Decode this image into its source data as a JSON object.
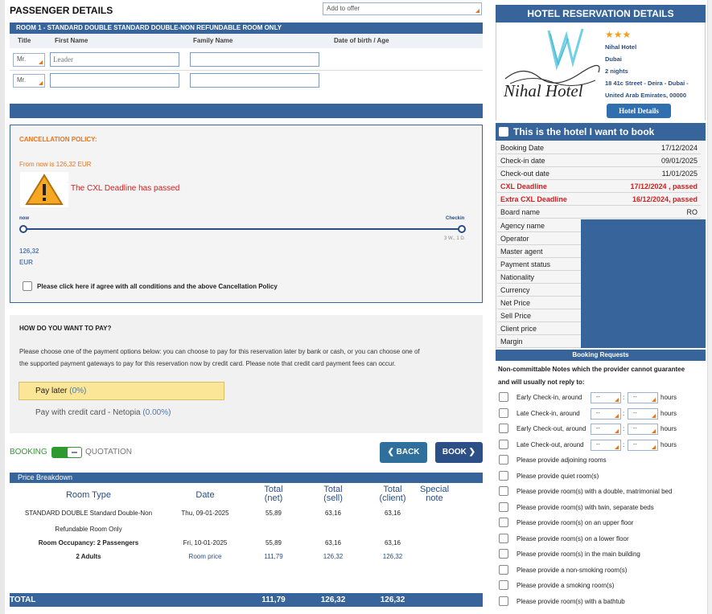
{
  "passenger": {
    "title": "PASSENGER DETAILS",
    "add_to_offer": "Add to offer",
    "room_header": "ROOM 1 - STANDARD DOUBLE STANDARD DOUBLE-NON REFUNDABLE ROOM ONLY",
    "col_title": "Title",
    "col_first": "First Name",
    "col_family": "Family Name",
    "col_dob": "Date of birth / Age",
    "rows": [
      {
        "title": "Mr.",
        "first_placeholder": "Leader"
      },
      {
        "title": "Mr.",
        "first_placeholder": ""
      }
    ]
  },
  "cancellation": {
    "heading": "CANCELLATION POLICY:",
    "from_now": "From now is 126,32 EUR",
    "deadline_msg": "The CXL Deadline has passed",
    "now_label": "now",
    "checkin_label": "Checkin",
    "checkin_sub": "3 W., 1 D.",
    "amount": "126,32",
    "currency": "EUR",
    "agree_text": "Please click here if agree with all conditions and the above Cancellation Policy"
  },
  "payment": {
    "heading": "HOW DO YOU WANT TO PAY?",
    "desc_line1": "Please choose one of the payment options below: you can choose to pay for this reservation later by bank or cash, or you can choose one of",
    "desc_line2": "the supported payment gateways to pay for this reservation now by credit card. Please note that credit card payment fees can occur.",
    "opt1_label": "Pay later",
    "opt1_pct": "(0%)",
    "opt2_label": "Pay with credit card - Netopia",
    "opt2_pct": "(0.00%)"
  },
  "mode": {
    "booking": "BOOKING",
    "quotation": "QUOTATION"
  },
  "buttons": {
    "back": "BACK",
    "book": "BOOK"
  },
  "price": {
    "title": "Price Breakdown",
    "headers": {
      "room_type": "Room Type",
      "date": "Date",
      "net_1": "Total",
      "net_2": "(net)",
      "sell_1": "Total",
      "sell_2": "(sell)",
      "client_1": "Total",
      "client_2": "(client)",
      "special_1": "Special",
      "special_2": "note"
    },
    "line1_room_a": "STANDARD DOUBLE Standard Double-Non",
    "line1_room_b": "Refundable Room Only",
    "line1_date": "Thu, 09-01-2025",
    "line1_net": "55,89",
    "line1_sell": "63,16",
    "line1_client": "63,16",
    "line2_room": "Room Occupancy: 2 Passengers",
    "line2_date": "Fri, 10-01-2025",
    "line2_net": "55,89",
    "line2_sell": "63,16",
    "line2_client": "63,16",
    "line3_room": "2 Adults",
    "line3_date": "Room price",
    "line3_net": "111,79",
    "line3_sell": "126,32",
    "line3_client": "126,32",
    "total_label": "TOTAL",
    "total_net": "111,79",
    "total_sell": "126,32",
    "total_client": "126,32"
  },
  "hotel": {
    "header": "HOTEL RESERVATION DETAILS",
    "stars": "★★★",
    "name": "Nihal Hotel",
    "city": "Dubai",
    "nights": "2 nights",
    "address_1": "18 41c Street - Deira - Dubai -",
    "address_2": "United Arab Emirates, 00000",
    "details_btn": "Hotel Details",
    "logo_text": "Nihal Hotel",
    "want_to_book": "This is the hotel I want to book",
    "rows": [
      {
        "label": "Booking Date",
        "value": "17/12/2024"
      },
      {
        "label": "Check-in date",
        "value": "09/01/2025"
      },
      {
        "label": "Check-out date",
        "value": "11/01/2025"
      },
      {
        "label": "CXL Deadline",
        "value": "17/12/2024 , passed"
      },
      {
        "label": "Extra CXL Deadline",
        "value": "16/12/2024, passed"
      },
      {
        "label": "Board name",
        "value": "RO"
      }
    ],
    "labels": [
      "Agency name",
      "Operator",
      "Master agent",
      "Payment status",
      "Nationality",
      "Currency",
      "Net Price",
      "Sell Price",
      "Client price",
      "Margin"
    ]
  },
  "requests": {
    "header": "Booking Requests",
    "note_1": "Non-committable Notes which the provider cannot guarantee",
    "note_2": "and will usually not reply to:",
    "dash": "--",
    "hours": "hours",
    "timed": [
      "Early Check-in, around",
      "Late Check-in, around",
      "Early Check-out, around",
      "Late Check-out, around"
    ],
    "items": [
      "Please provide adjoining rooms",
      "Please provide quiet room(s)",
      "Please provide room(s) with a double, matrimonial bed",
      "Please provide room(s) with twin, separate beds",
      "Please provide room(s) on an upper floor",
      "Please provide room(s) on a lower floor",
      "Please provide room(s) in the main building",
      "Please provide a non-smoking room(s)",
      "Please provide a smoking room(s)",
      "Please provide room(s) with a bathtub"
    ]
  },
  "colors": {
    "brand": "#37649a",
    "accent": "#e8731c",
    "red": "#d21f1f",
    "green": "#2e9a2e"
  }
}
